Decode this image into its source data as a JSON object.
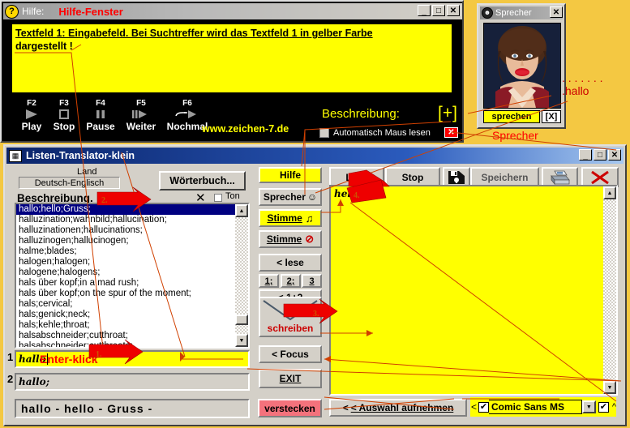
{
  "help_window": {
    "icon": "question-mark-icon",
    "title_label": "Hilfe:",
    "title_red": "Hilfe-Fenster",
    "minimize": "_",
    "maximize": "□",
    "close": "✕",
    "yellow_text_line1": "Textfeld 1: Eingabefeld. Bei Suchtreffer wird das Textfeld 1 in gelber Farbe",
    "yellow_text_line2": "dargestellt !",
    "fkeys": [
      {
        "key": "F2",
        "label": "Play",
        "glyph": "▶"
      },
      {
        "key": "F3",
        "label": "Stop",
        "glyph": "■"
      },
      {
        "key": "F4",
        "label": "Pause",
        "glyph": "‖"
      },
      {
        "key": "F5",
        "label": "Weiter",
        "glyph": "❙▶"
      },
      {
        "key": "F6",
        "label": "Nochmal",
        "glyph": "↷▶"
      }
    ],
    "url": "www.zeichen-7.de",
    "beschreibung_label": "Beschreibung:",
    "plus_button": "[+]",
    "auto_maus_label": "Automatisch Maus lesen",
    "close_red": "✕"
  },
  "sprecher_window": {
    "icon": "face-icon",
    "title": "Sprecher",
    "close": "✕",
    "speak_button": "sprechen",
    "x_button": "[X]",
    "annot_hallo": ". . . . . . . .hallo",
    "annot_caption": "Sprecher"
  },
  "main_window": {
    "icon": "translator-icon",
    "title": "Listen-Translator-klein",
    "minimize": "_",
    "maximize": "□",
    "close": "✕",
    "land_label": "Land",
    "land_value": "Deutsch-Englisch",
    "woerterbuch_button": "Wörterbuch...",
    "beschreibung_label": "Beschreibung.",
    "num2_label": "2.",
    "num3_label": "3.",
    "clear_x": "✕",
    "ton_label": "Ton",
    "list_items": [
      "hallo;hello;Gruss;",
      "halluzination;wahnbild;hallucination;",
      "halluzinationen;hallucinations;",
      "halluzinogen;hallucinogen;",
      "halme;blades;",
      "halogen;halogen;",
      "halogene;halogens;",
      "hals über kopf;in a mad rush;",
      "hals über kopf;on the spur of the moment;",
      "hals;cervical;",
      "hals;genick;neck;",
      "hals;kehle;throat;",
      "halsabschneider;cutthroat;",
      "halsabschneider;cutthroats;"
    ],
    "field1_number": "1",
    "field1_value": "hallo",
    "field1_annotation": "Enter-klick",
    "field2_number": "2",
    "field2_value": "hallo;",
    "result_bar": "hallo  -  hello  -  Gruss  -",
    "mid_buttons": {
      "hilfe": "Hilfe",
      "sprecher": "Sprecher",
      "stimme_on": "Stimme",
      "stimme_off": "Stimme",
      "lese": "< lese",
      "n1": "1;",
      "n2": "2;",
      "n3": "3",
      "one_plus_two": "< 1+2",
      "schreiben": "schreiben",
      "focus": "< Focus",
      "exit": "EXIT"
    },
    "toolbar": {
      "lese": "Lese",
      "stop": "Stop",
      "save_icon": "floppy-disk-icon",
      "speichern": "Speichern",
      "print_icon": "printer-icon",
      "close_icon": "red-x-icon"
    },
    "big_yellow_text": "hello",
    "marker3": "3.",
    "marker4": "4.",
    "auswahl_button": "< Auswahl aufnehmen",
    "font_arrow": "<",
    "font_name": "Comic Sans MS",
    "font_checkbox": "✔",
    "font_checkbox2": "✔",
    "font_dropdown_arrow": "▼",
    "font_caret": "^",
    "verstecken_button": "verstecken"
  },
  "colors": {
    "yellow": "#ffff00",
    "desktop": "#f4c842",
    "annotation_red": "#cc0000",
    "titlebar_blue": "#0a246a",
    "selection_blue": "#000080",
    "verstecken_pink": "#f4727c"
  }
}
